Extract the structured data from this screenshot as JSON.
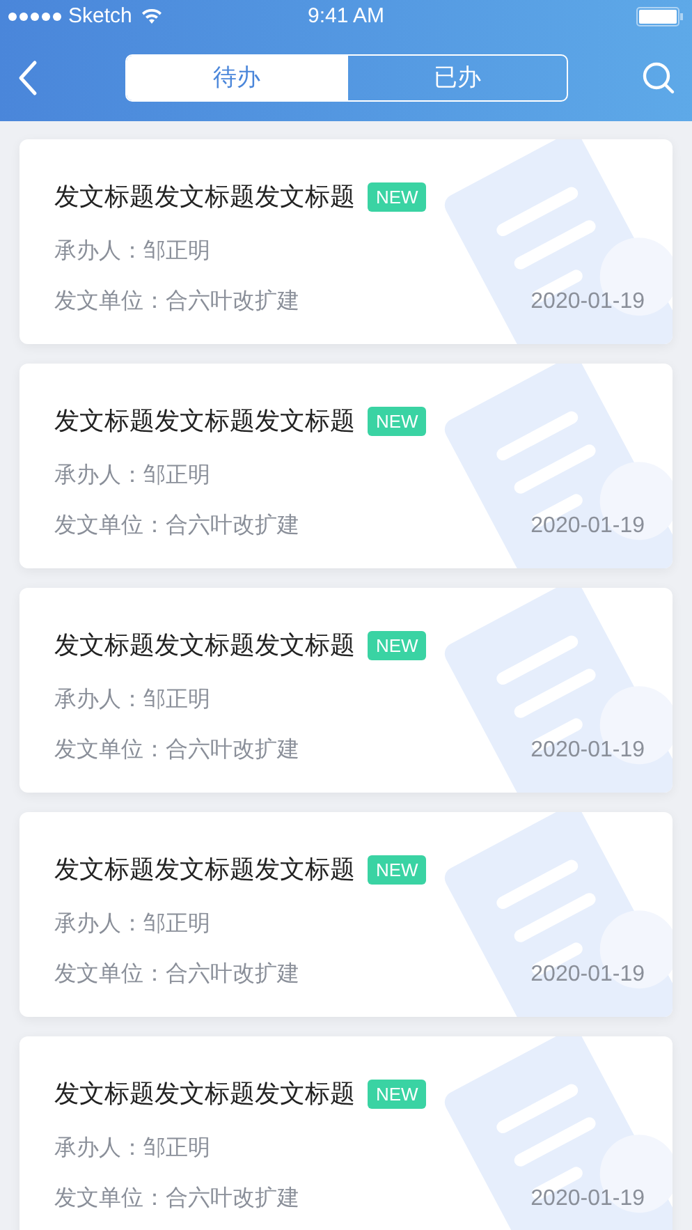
{
  "status_bar": {
    "carrier": "Sketch",
    "time": "9:41 AM"
  },
  "tabs": [
    {
      "label": "待办",
      "selected": true
    },
    {
      "label": "已办",
      "selected": false
    }
  ],
  "documents": [
    {
      "title": "发文标题发文标题发文标题",
      "badge": "NEW",
      "handler": "承办人：邹正明",
      "unit": "发文单位：合六叶改扩建",
      "date": "2020-01-19"
    },
    {
      "title": "发文标题发文标题发文标题",
      "badge": "NEW",
      "handler": "承办人：邹正明",
      "unit": "发文单位：合六叶改扩建",
      "date": "2020-01-19"
    },
    {
      "title": "发文标题发文标题发文标题",
      "badge": "NEW",
      "handler": "承办人：邹正明",
      "unit": "发文单位：合六叶改扩建",
      "date": "2020-01-19"
    },
    {
      "title": "发文标题发文标题发文标题",
      "badge": "NEW",
      "handler": "承办人：邹正明",
      "unit": "发文单位：合六叶改扩建",
      "date": "2020-01-19"
    },
    {
      "title": "发文标题发文标题发文标题",
      "badge": "NEW",
      "handler": "承办人：邹正明",
      "unit": "发文单位：合六叶改扩建",
      "date": "2020-01-19"
    }
  ]
}
